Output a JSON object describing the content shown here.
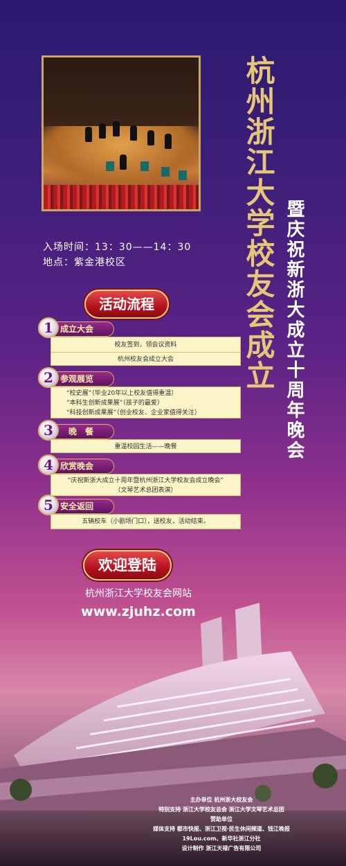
{
  "title": {
    "main": "杭州浙江大学校友会成立",
    "sub": "暨庆祝新浙大成立十周年晚会"
  },
  "event": {
    "time": "入场时间：13：30——14：30",
    "location": "地点：紫金港校区"
  },
  "flow_badge": "活动流程",
  "steps": [
    {
      "num": "1",
      "label": "成立大会",
      "lines": [
        "校友签到，领会议资料",
        "杭州校友会成立大会"
      ]
    },
    {
      "num": "2",
      "label": "参观展览",
      "lines": [
        "“校史展”（毕业20年以上校友值得重温）",
        "“本科生创新成果展”（孩子的最爱）",
        "“科技创新成果展”（创业校友、企业家值得关注）"
      ]
    },
    {
      "num": "3",
      "label": "晚　餐",
      "lines": [
        "重温校园生活——晚餐"
      ]
    },
    {
      "num": "4",
      "label": "欣赏晚会",
      "lines": [
        "“庆祝新浙大成立十周年暨杭州浙江大学校友会成立晚会”",
        "（文琴艺术总团表演）"
      ]
    },
    {
      "num": "5",
      "label": "安全返回",
      "lines": [
        "五辆校车（小剧场门口），送校友，活动结束。"
      ]
    }
  ],
  "welcome_badge": "欢迎登陆",
  "site": {
    "name": "杭州浙江大学校友会网站",
    "url": "www.zjuhz.com"
  },
  "credits": {
    "host": "主办单位  杭州浙大校友会",
    "special": "特别支持  浙江大学校友总会   浙江大学文琴艺术总团",
    "sponsor": "赞助单位",
    "media1": "媒体支持  都市快报、浙江卫视·民生休闲频道、钱江晚报",
    "media2": "19Lou.com、新华社浙江分社",
    "design": "设计制作  浙江天禄广告有限公司"
  },
  "colors": {
    "gold": "#e6c77a",
    "badge_red": "#b5121e",
    "box_bg": "#fbf4c8"
  }
}
